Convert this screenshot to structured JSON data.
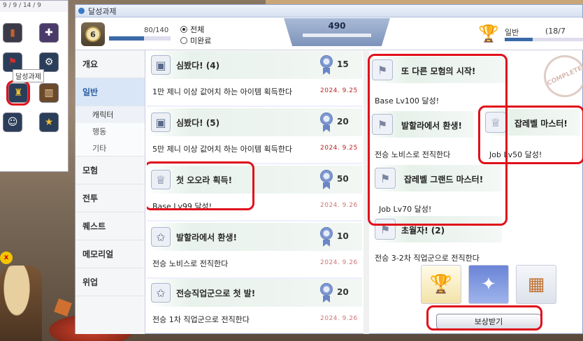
{
  "quickbar": {
    "top_text": "9 / 9 / 14 / 9",
    "tooltip": "달성과제"
  },
  "window": {
    "title": "달성과제"
  },
  "header": {
    "level": "6",
    "progress_text": "80/140",
    "progress_fraction": 0.57,
    "filter_all": "전체",
    "filter_incomplete": "미완료",
    "points": "490",
    "rank_label": "일반",
    "rank_count": "(18/7"
  },
  "sidebar": {
    "items": [
      {
        "label": "개요"
      },
      {
        "label": "일반"
      },
      {
        "label": "캐릭터"
      },
      {
        "label": "행동"
      },
      {
        "label": "기타"
      },
      {
        "label": "모험"
      },
      {
        "label": "전투"
      },
      {
        "label": "퀘스트"
      },
      {
        "label": "메모리얼"
      },
      {
        "label": "위업"
      }
    ]
  },
  "achievements": [
    {
      "title": "심봤다! (4)",
      "points": "15",
      "desc": "1만 제니 이상 값어치 하는 아이템 획득한다",
      "date": "2024. 9.25"
    },
    {
      "title": "심봤다! (5)",
      "points": "20",
      "desc": "5만 제니 이상 값어치 하는 아이템 획득한다",
      "date": "2024. 9.25"
    },
    {
      "title": "첫 오오라 획득!",
      "points": "50",
      "desc": "Base Lv99 달성!",
      "date": "2024. 9.26"
    },
    {
      "title": "발할라에서 환생!",
      "points": "10",
      "desc": "전승 노비스로 전직한다",
      "date": "2024. 9.26"
    },
    {
      "title": "전승직업군으로 첫 발!",
      "points": "20",
      "desc": "전승 1차 직업군으로 전직한다",
      "date": "2024. 9.26"
    }
  ],
  "detail": {
    "tree": [
      {
        "title": "또 다른 모험의 시작!",
        "desc": "Base Lv100 달성!"
      },
      {
        "title": "발할라에서 환생!",
        "desc": "전승 노비스로 전직한다"
      },
      {
        "title": "잡레벨 마스터!",
        "desc": "Job Lv50 달성!"
      },
      {
        "title": "잡레벨 그랜드 마스터!",
        "desc": "Job Lv70 달성!"
      },
      {
        "title": "초월자! (2)",
        "desc": "전승 3-2차 직업군으로 전직한다"
      }
    ],
    "stamp": "COMPLETE",
    "claim_button": "보상받기"
  }
}
